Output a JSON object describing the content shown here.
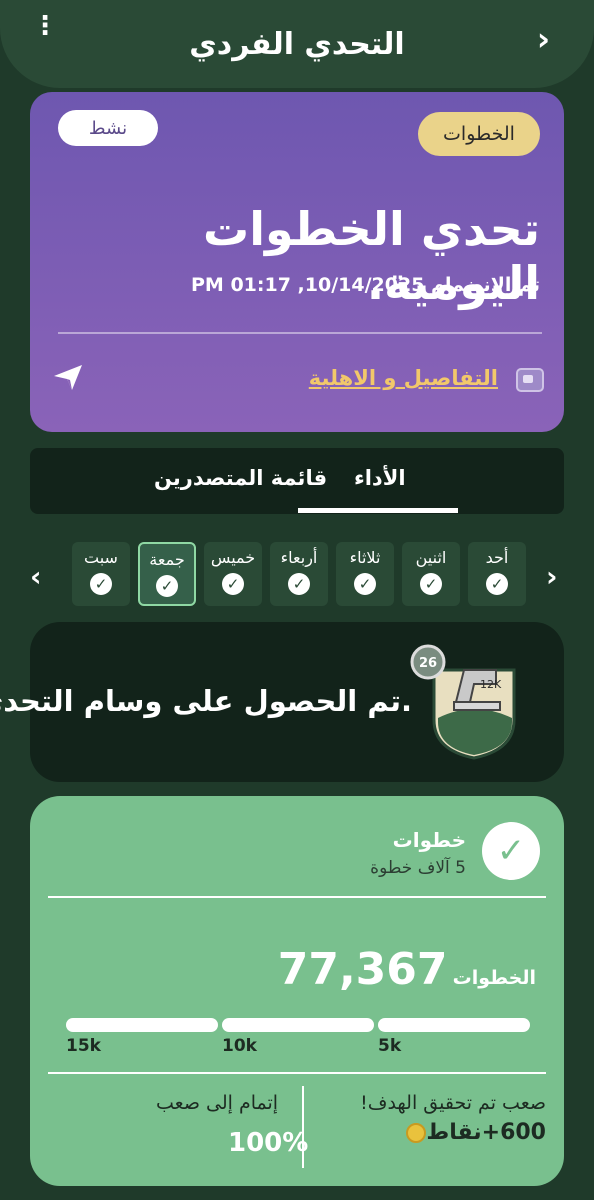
{
  "header": {
    "title": "التحدي الفردي",
    "back_icon": "chevron-right-icon",
    "menu_icon": "more-vertical-icon"
  },
  "challenge": {
    "category": "الخطوات",
    "status": "نشط",
    "title": "تحدي الخطوات اليومية.",
    "joined": "تم الانضمام 10/14/2025, 01:17 PM",
    "details_link": "التفاصيل و الاهلية",
    "share_icon": "share-icon",
    "details_icon": "card-icon"
  },
  "tabs": [
    {
      "label": "الأداء",
      "active": true
    },
    {
      "label": "قائمة المتصدرين",
      "active": false
    }
  ],
  "days": [
    {
      "label": "أحد",
      "done": true,
      "selected": false
    },
    {
      "label": "اثنين",
      "done": true,
      "selected": false
    },
    {
      "label": "ثلاثاء",
      "done": true,
      "selected": false
    },
    {
      "label": "أربعاء",
      "done": true,
      "selected": false
    },
    {
      "label": "خميس",
      "done": true,
      "selected": false
    },
    {
      "label": "جمعة",
      "done": true,
      "selected": true
    },
    {
      "label": "سبت",
      "done": true,
      "selected": false
    }
  ],
  "badge": {
    "text": "تم الحصول على وسام التحدي.",
    "count": "26",
    "badge_label": "12K"
  },
  "progress_card": {
    "label": "خطوات",
    "sub": "5 آلاف خطوة",
    "total": "77,367",
    "unit": "الخطوات",
    "ticks": [
      "15k",
      "10k",
      "5k"
    ],
    "progress": [
      1,
      1,
      1
    ],
    "achieved": "صعب تم تحقيق الهدف!",
    "points": "600+نقاط",
    "complete_label": "إتمام إلى صعب",
    "complete_value": "100%"
  },
  "colors": {
    "accent": "#79c08e",
    "purple": "#7a5cb4",
    "gold": "#ead38a",
    "bg": "#1f3a2a"
  }
}
